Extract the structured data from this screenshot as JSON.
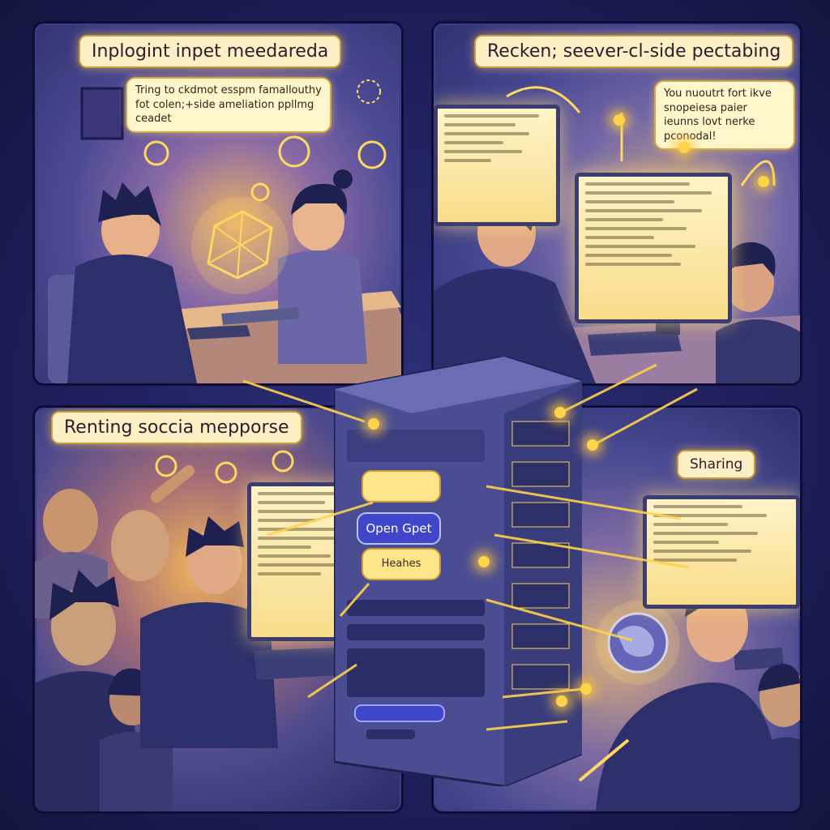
{
  "panels": {
    "top_left": {
      "caption": "Inplogint inpet meedareda",
      "bubble": "Tring to ckdmot esspm famallouthy fot colen;+side ameliation ppllmg ceadet"
    },
    "top_right": {
      "caption": "Recken; seever-cl-side pectabing",
      "bubble": "You nuoutrt fort ikve snopeiesa paier ieunns lovt nerke pconodal!"
    },
    "bottom_left": {
      "caption": "Renting soccia mepporse"
    },
    "bottom_right": {
      "caption": "Sharing"
    }
  },
  "server": {
    "top_label": "",
    "middle_label": "Open Gpet",
    "bottom_label": "Heahes"
  },
  "colors": {
    "glow": "#ffd34a",
    "caption_bg": "#fdf0c4",
    "panel_border": "#0e0e33",
    "server_body": "#4a4d92",
    "pill_blue": "#3f47c8"
  }
}
